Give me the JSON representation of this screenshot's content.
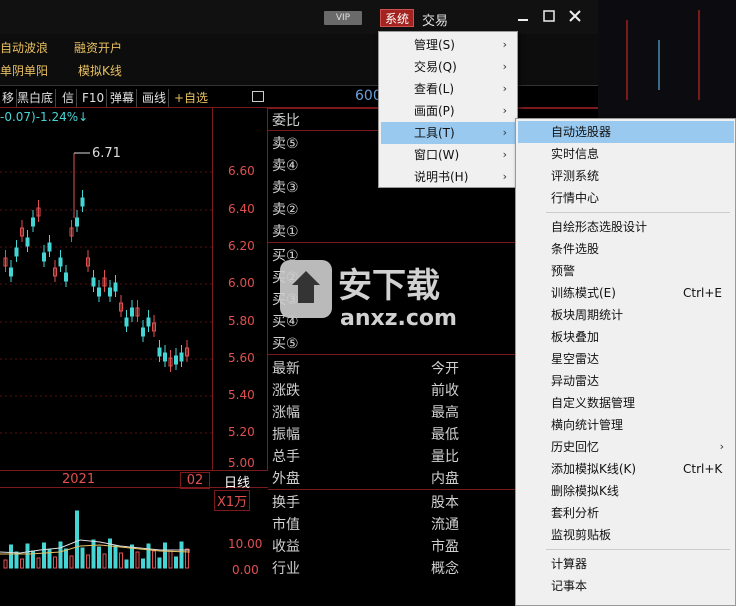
{
  "titlebar": {
    "vip_label": "VIP",
    "system_label": "系统",
    "trade_label": "交易"
  },
  "toolbar": {
    "items": [
      "自动波浪",
      "融资开户",
      "单阴单阳",
      "模拟K线"
    ]
  },
  "tabs": [
    "移",
    "黑白底",
    "信",
    "F10",
    "弹幕",
    "画线",
    "+自选"
  ],
  "stock_code_partial": "600",
  "price_change": "-0.07)-1.24%↓",
  "chart": {
    "high_label": "6.71",
    "y_ticks": [
      "6.60",
      "6.40",
      "6.20",
      "6.00",
      "5.80",
      "5.60",
      "5.40",
      "5.20",
      "5.00"
    ],
    "year_label": "2021",
    "month_label": "02",
    "period_label": "日线",
    "volume_unit": "X1万",
    "volume_ticks": [
      "10.00",
      "0.00"
    ]
  },
  "order_book": {
    "header": "委比",
    "sells": [
      "卖⑤",
      "卖④",
      "卖③",
      "卖②",
      "卖①"
    ],
    "buys": [
      "买①",
      "买②",
      "买③",
      "买④",
      "买⑤"
    ],
    "stats_left": [
      "最新",
      "涨跌",
      "涨幅",
      "振幅",
      "总手",
      "外盘",
      "换手",
      "市值",
      "收益",
      "行业"
    ],
    "stats_right": [
      "今开",
      "前收",
      "最高",
      "最低",
      "量比",
      "内盘",
      "股本",
      "流通",
      "市盈",
      "概念"
    ]
  },
  "main_menu": {
    "items": [
      {
        "label": "管理(S)",
        "has_sub": true
      },
      {
        "label": "交易(Q)",
        "has_sub": true
      },
      {
        "label": "查看(L)",
        "has_sub": true
      },
      {
        "label": "画面(P)",
        "has_sub": true
      },
      {
        "label": "工具(T)",
        "has_sub": true
      },
      {
        "label": "窗口(W)",
        "has_sub": true
      },
      {
        "label": "说明书(H)",
        "has_sub": true
      }
    ],
    "active_index": 4
  },
  "tools_menu": {
    "items": [
      {
        "label": "自动选股器",
        "shortcut": ""
      },
      {
        "label": "实时信息",
        "shortcut": ""
      },
      {
        "label": "评测系统",
        "shortcut": ""
      },
      {
        "label": "行情中心",
        "shortcut": ""
      },
      {
        "label": "自绘形态选股设计",
        "shortcut": ""
      },
      {
        "label": "条件选股",
        "shortcut": ""
      },
      {
        "label": "预警",
        "shortcut": ""
      },
      {
        "label": "训练模式(E)",
        "shortcut": "Ctrl+E"
      },
      {
        "label": "板块周期统计",
        "shortcut": ""
      },
      {
        "label": "板块叠加",
        "shortcut": ""
      },
      {
        "label": "星空雷达",
        "shortcut": ""
      },
      {
        "label": "异动雷达",
        "shortcut": ""
      },
      {
        "label": "自定义数据管理",
        "shortcut": ""
      },
      {
        "label": "横向统计管理",
        "shortcut": ""
      },
      {
        "label": "历史回忆",
        "shortcut": ""
      },
      {
        "label": "添加模拟K线(K)",
        "shortcut": "Ctrl+K"
      },
      {
        "label": "删除模拟K线",
        "shortcut": ""
      },
      {
        "label": "套利分析",
        "shortcut": ""
      },
      {
        "label": "监视剪贴板",
        "shortcut": ""
      },
      {
        "label": "计算器",
        "shortcut": ""
      },
      {
        "label": "记事本",
        "shortcut": ""
      }
    ],
    "active_index": 0
  },
  "watermark": {
    "text": "安下载",
    "sub": "anxz.com"
  },
  "colors": {
    "menu_bg": "#f0f0f0",
    "menu_highlight": "#99c9ef",
    "system_button": "#a2231f",
    "up_red": "#e05050",
    "down_cyan": "#46d5d5"
  }
}
